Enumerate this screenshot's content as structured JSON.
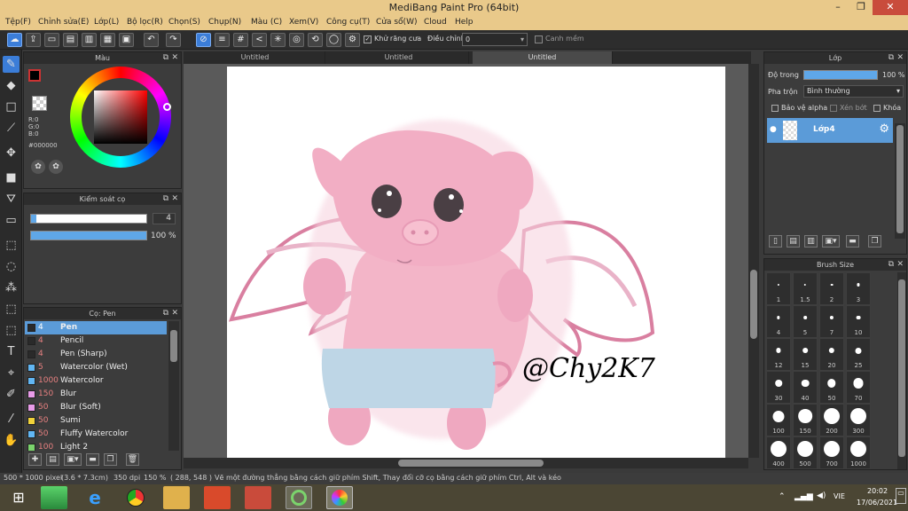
{
  "window": {
    "title": "MediBang Paint Pro (64bit)"
  },
  "menu": [
    "Tệp(F)",
    "Chỉnh sửa(E)",
    "Lớp(L)",
    "Bộ lọc(R)",
    "Chọn(S)",
    "Chụp(N)",
    "Màu (C)",
    "Xem(V)",
    "Công cụ(T)",
    "Cửa sổ(W)",
    "Cloud",
    "Help"
  ],
  "toolbar": {
    "antialias_label": "Khử răng cưa",
    "correction_label": "Điều chỉnh",
    "correction_value": "0",
    "snap_label": "Canh mềm"
  },
  "color_panel": {
    "title": "Màu",
    "r": "R:0",
    "g": "G:0",
    "b": "B:0",
    "hex": "#000000"
  },
  "brush_control": {
    "title": "Kiểm soát cọ",
    "size": "4",
    "opacity": "100 %",
    "opacity_fraction": 1.0
  },
  "brush_panel": {
    "title": "Cọ: Pen",
    "items": [
      {
        "size": "4",
        "name": "Pen",
        "color": "#2a2a2a",
        "active": true
      },
      {
        "size": "4",
        "name": "Pencil",
        "color": "#2a2a2a"
      },
      {
        "size": "4",
        "name": "Pen (Sharp)",
        "color": "#2a2a2a"
      },
      {
        "size": "5",
        "name": "Watercolor (Wet)",
        "color": "#61b6f3"
      },
      {
        "size": "1000",
        "name": "Watercolor",
        "color": "#61b6f3"
      },
      {
        "size": "150",
        "name": "Blur",
        "color": "#e89be8"
      },
      {
        "size": "50",
        "name": "Blur (Soft)",
        "color": "#e89be8"
      },
      {
        "size": "50",
        "name": "Sumi",
        "color": "#f0d23a"
      },
      {
        "size": "50",
        "name": "Fluffy Watercolor",
        "color": "#61b6f3"
      },
      {
        "size": "100",
        "name": "Light 2",
        "color": "#7bd36c"
      }
    ]
  },
  "tabs": [
    "Untitled",
    "Untitled",
    "Untitled"
  ],
  "canvas": {
    "signature": "@Chy2K7"
  },
  "layer_panel": {
    "title": "Lớp",
    "opacity_label": "Độ trong",
    "opacity_value": "100 %",
    "blend_label": "Pha trộn",
    "blend_value": "Bình thường",
    "protect_alpha": "Bảo vệ alpha",
    "clipping": "Xén bớt",
    "lock": "Khóa",
    "layer_name": "Lớp4"
  },
  "brush_size": {
    "title": "Brush Size",
    "sizes": [
      "1",
      "1.5",
      "2",
      "3",
      "4",
      "5",
      "7",
      "10",
      "12",
      "15",
      "20",
      "25",
      "30",
      "40",
      "50",
      "70",
      "100",
      "150",
      "200",
      "300",
      "400",
      "500",
      "700",
      "1000"
    ]
  },
  "status": {
    "dims": "500 * 1000 pixel",
    "cm": "(3.6 * 7.3cm)",
    "dpi": "350 dpi",
    "zoom": "150 %",
    "coords": "( 288, 548 )",
    "hint": "Vẽ một đường thẳng bằng cách giữ phím Shift, Thay đổi cỡ cọ bằng cách giữ phím Ctrl, Alt và kéo"
  },
  "tray": {
    "lang": "VIE",
    "time": "20:02",
    "date": "17/06/2021"
  }
}
